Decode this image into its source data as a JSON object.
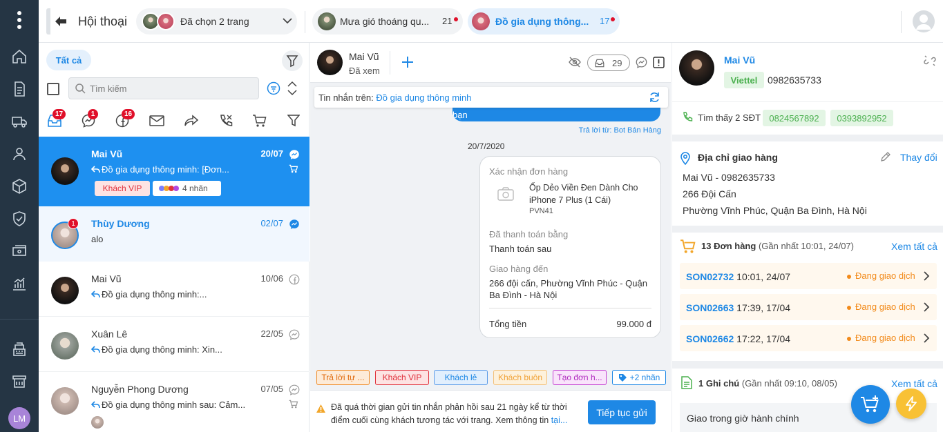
{
  "header": {
    "title": "Hội thoại",
    "page_selector": "Đã chọn 2 trang",
    "tabs": [
      {
        "label": "Mưa gió thoáng qu...",
        "count": "21"
      },
      {
        "label": "Đồ gia dụng thông...",
        "count": "17"
      }
    ]
  },
  "sidebar": {
    "user_initials": "LM"
  },
  "conversations": {
    "filter_all": "Tất cả",
    "search_placeholder": "Tìm kiếm",
    "badges": {
      "inbox": "17",
      "messenger": "1",
      "facebook": "16"
    },
    "items": [
      {
        "name": "Mai Vũ",
        "date": "20/07",
        "message": "Đồ gia dụng thông minh: [Đơn...",
        "tag": "Khách VIP",
        "labels": "4 nhãn"
      },
      {
        "name": "Thùy Dương",
        "date": "02/07",
        "message": "alo",
        "badge": "1"
      },
      {
        "name": "Mai Vũ",
        "date": "10/06",
        "message": "Đồ gia dụng thông minh:..."
      },
      {
        "name": "Xuân Lê",
        "date": "22/05",
        "message": "Đồ gia dụng thông minh: Xin..."
      },
      {
        "name": "Nguyễn Phong Dương",
        "date": "07/05",
        "message": "Đồ gia dụng thông minh sau: Cảm..."
      }
    ]
  },
  "chat": {
    "name": "Mai Vũ",
    "status": "Đã xem",
    "counter": "29",
    "source_label": "Tin nhắn trên:",
    "source_page": "Đồ gia dụng thông minh",
    "bubble_text": "bạn",
    "reply_from": "Trả lời từ: Bot Bán Hàng",
    "date_sep": "20/7/2020",
    "order": {
      "title": "Xác nhận đơn hàng",
      "product": "Ốp Dẻo Viền Đen Dành Cho iPhone 7 Plus (1 Cái)",
      "sku": "PVN41",
      "paid_label": "Đã thanh toán bằng",
      "paid_value": "Thanh toán sau",
      "ship_label": "Giao hàng đến",
      "ship_value": "266 đội cấn, Phường Vĩnh Phúc - Quận Ba Đình - Hà Nội",
      "total_label": "Tổng tiền",
      "total_value": "99.000 đ"
    },
    "quick_tags": [
      "Trả lời tự ...",
      "Khách VIP",
      "Khách lẻ",
      "Khách buôn",
      "Tạo đơn h...",
      "+2 nhãn"
    ],
    "warning": "Đã quá thời gian gửi tin nhắn phản hồi sau 21 ngày kể từ thời điểm cuối cùng khách tương tác với trang. Xem thông tin",
    "warning_link": "tại...",
    "continue_button": "Tiếp tục gửi"
  },
  "customer": {
    "name": "Mai Vũ",
    "carrier": "Viettel",
    "phone": "0982635733",
    "found_label": "Tìm thấy 2 SĐT",
    "phones": [
      "0824567892",
      "0393892952"
    ],
    "address_title": "Địa chỉ giao hàng",
    "address_edit": "Thay đổi",
    "address_lines": [
      "Mai Vũ - 0982635733",
      "266 Đội Cấn",
      "Phường Vĩnh Phúc, Quận Ba Đình, Hà Nội"
    ],
    "orders_title": "13 Đơn hàng",
    "orders_sub": "(Gần nhất 10:01, 24/07)",
    "see_all": "Xem tất cả",
    "orders": [
      {
        "code": "SON02732",
        "time": "10:01, 24/07",
        "status": "Đang giao dịch"
      },
      {
        "code": "SON02663",
        "time": "17:39, 17/04",
        "status": "Đang giao dịch"
      },
      {
        "code": "SON02662",
        "time": "17:22, 17/04",
        "status": "Đang giao dịch"
      }
    ],
    "notes_title": "1 Ghi chú",
    "notes_sub": "(Gần nhất 09:10, 08/05)",
    "note_text": "Giao trong giờ hành chính"
  }
}
